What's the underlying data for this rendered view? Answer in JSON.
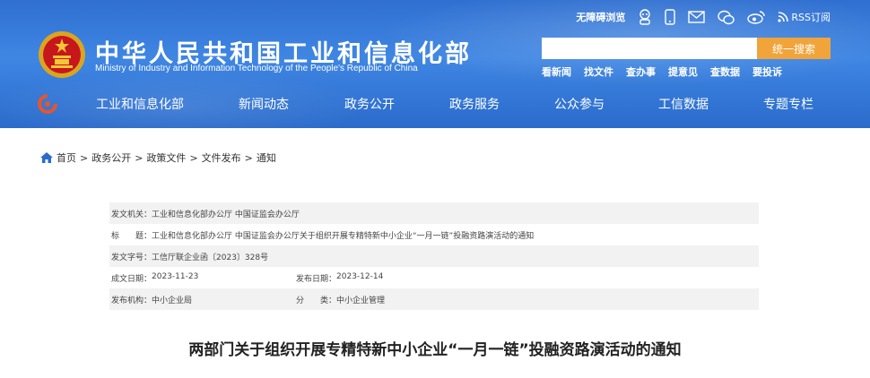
{
  "header": {
    "title": "中华人民共和国工业和信息化部",
    "subtitle": "Ministry of Industry and Information Technology of the People's Republic of China",
    "barrier_free": "无障碍浏览",
    "rss": "RSS订阅",
    "colors": {
      "header_blue": "#3f86e3",
      "search_orange": "#f0a43a"
    }
  },
  "search": {
    "placeholder": "",
    "button_label": "统一搜索"
  },
  "quick_links": [
    "看新闻",
    "找文件",
    "查办事",
    "提意见",
    "查数据",
    "要投诉"
  ],
  "nav": [
    "工业和信息化部",
    "新闻动态",
    "政务公开",
    "政务服务",
    "公众参与",
    "工信数据",
    "专题专栏"
  ],
  "breadcrumb": [
    "首页",
    "政务公开",
    "政策文件",
    "文件发布",
    "通知"
  ],
  "meta": {
    "issuer_label": "发文机关：",
    "issuer": "工业和信息化部办公厅 中国证监会办公厅",
    "title_label": "标　　题：",
    "title": "工业和信息化部办公厅 中国证监会办公厅关于组织开展专精特新中小企业“一月一链”投融资路演活动的通知",
    "doc_no_label": "发文字号：",
    "doc_no": "工信厅联企业函〔2023〕328号",
    "date_made_label": "成文日期：",
    "date_made": "2023-11-23",
    "date_pub_label": "发布日期：",
    "date_pub": "2023-12-14",
    "org_label": "发布机构：",
    "org": "中小企业局",
    "category_label": "分　　类：",
    "category": "中小企业管理"
  },
  "article": {
    "title": "两部门关于组织开展专精特新中小企业“一月一链”投融资路演活动的通知"
  }
}
